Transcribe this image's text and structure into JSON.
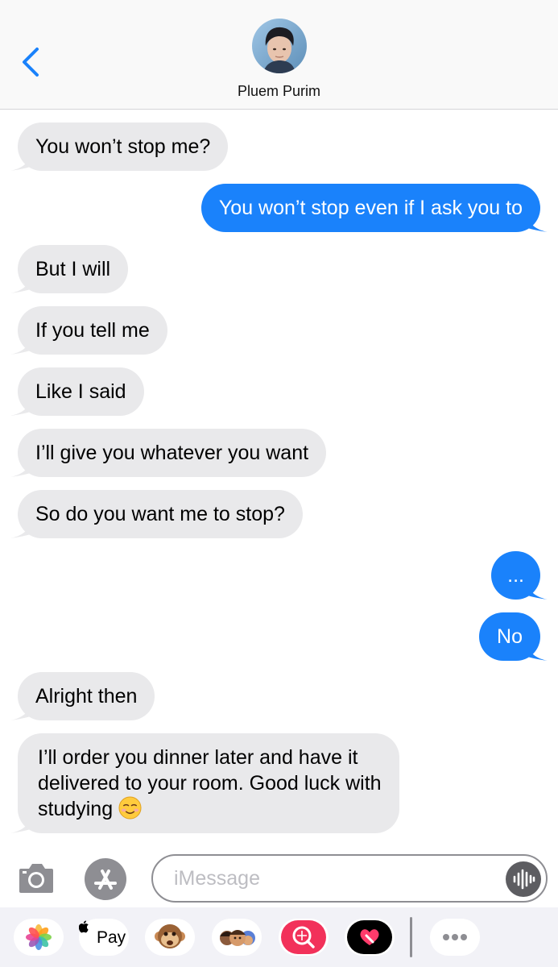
{
  "header": {
    "contact_name": "Pluem Purim"
  },
  "messages": [
    {
      "side": "in",
      "text": "You won’t stop me?"
    },
    {
      "side": "out",
      "text": "You won’t stop even if I ask you to"
    },
    {
      "side": "in",
      "text": "But I will"
    },
    {
      "side": "in",
      "text": "If you tell me"
    },
    {
      "side": "in",
      "text": "Like I said"
    },
    {
      "side": "in",
      "text": "I’ll give you whatever you want"
    },
    {
      "side": "in",
      "text": "So do you want me to stop?"
    },
    {
      "side": "out",
      "text": "..."
    },
    {
      "side": "out",
      "text": "No"
    },
    {
      "side": "in",
      "text": "Alright then"
    },
    {
      "side": "in",
      "text": "I’ll order you dinner later and have it\ndelivered to your room. Good luck with\nstudying ",
      "emoji": "smiling-face-emoji"
    }
  ],
  "input": {
    "placeholder": "iMessage"
  },
  "app_drawer": {
    "apple_pay_label": "Pay",
    "apps": [
      "photos-icon",
      "apple-pay-icon",
      "monkey-animoji-icon",
      "memoji-icon",
      "search-images-icon",
      "digital-touch-icon",
      "more-icon"
    ]
  },
  "colors": {
    "outgoing_bubble": "#1a82fb",
    "incoming_bubble": "#e9e9eb",
    "accent": "#1a82fb"
  }
}
